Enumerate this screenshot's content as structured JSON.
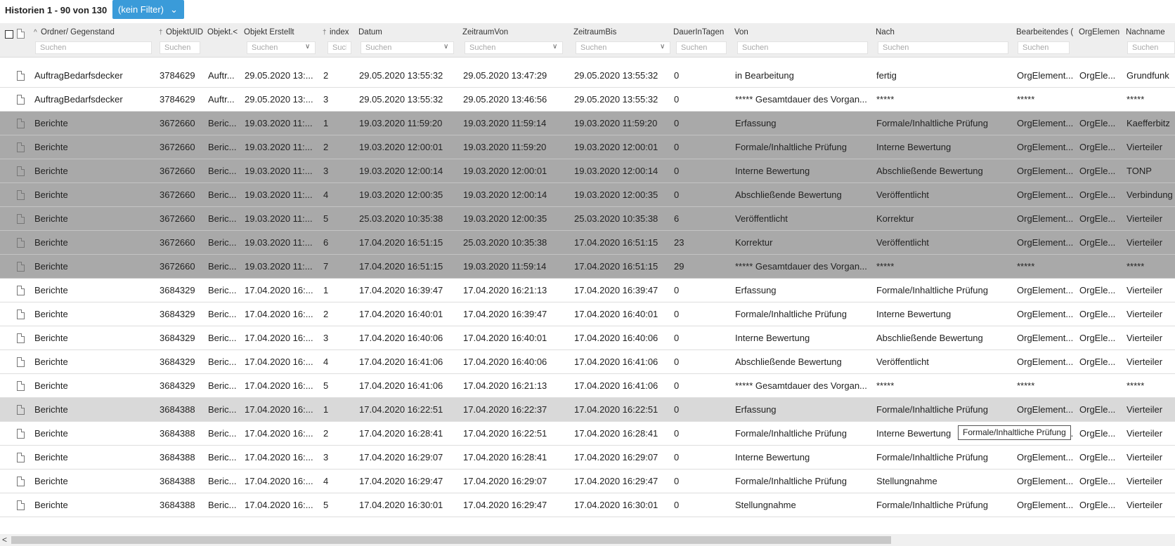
{
  "toolbar": {
    "title": "Historien 1 - 90 von 130",
    "filter_label": "(kein Filter)"
  },
  "columns": [
    {
      "key": "ordner",
      "label": "Ordner/ Gegenstand",
      "placeholder": "Suchen"
    },
    {
      "key": "uid",
      "label": "ObjektUID",
      "placeholder": "Suchen"
    },
    {
      "key": "objekt",
      "label": "Objekt.<",
      "placeholder": ""
    },
    {
      "key": "erstellt",
      "label": "Objekt Erstellt",
      "placeholder": "Suchen"
    },
    {
      "key": "index",
      "label": "index",
      "placeholder": "Suche"
    },
    {
      "key": "datum",
      "label": "Datum",
      "placeholder": "Suchen"
    },
    {
      "key": "von_zeit",
      "label": "ZeitraumVon",
      "placeholder": "Suchen"
    },
    {
      "key": "bis_zeit",
      "label": "ZeitraumBis",
      "placeholder": "Suchen"
    },
    {
      "key": "dauer",
      "label": "DauerInTagen",
      "placeholder": "Suchen"
    },
    {
      "key": "von",
      "label": "Von",
      "placeholder": "Suchen"
    },
    {
      "key": "nach",
      "label": "Nach",
      "placeholder": "Suchen"
    },
    {
      "key": "bearb",
      "label": "Bearbeitendes (",
      "placeholder": "Suchen"
    },
    {
      "key": "org",
      "label": "OrgElemen",
      "placeholder": ""
    },
    {
      "key": "nachname",
      "label": "Nachname",
      "placeholder": "Suchen"
    }
  ],
  "rows": [
    {
      "state": "normal",
      "cells": [
        "AuftragBedarfsdecker",
        "3784629",
        "Auftr...",
        "29.05.2020 13:...",
        "2",
        "29.05.2020 13:55:32",
        "29.05.2020 13:47:29",
        "29.05.2020 13:55:32",
        "0",
        "in Bearbeitung",
        "fertig",
        "OrgElement...",
        "OrgEle...",
        "Grundfunk"
      ]
    },
    {
      "state": "normal",
      "cells": [
        "AuftragBedarfsdecker",
        "3784629",
        "Auftr...",
        "29.05.2020 13:...",
        "3",
        "29.05.2020 13:55:32",
        "29.05.2020 13:46:56",
        "29.05.2020 13:55:32",
        "0",
        "***** Gesamtdauer des Vorgan...",
        "*****",
        "*****",
        "",
        "*****"
      ]
    },
    {
      "state": "sel",
      "cells": [
        "Berichte",
        "3672660",
        "Beric...",
        "19.03.2020 11:...",
        "1",
        "19.03.2020 11:59:20",
        "19.03.2020 11:59:14",
        "19.03.2020 11:59:20",
        "0",
        "Erfassung",
        "Formale/Inhaltliche Prüfung",
        "OrgElement...",
        "OrgEle...",
        "Kaefferbitz"
      ]
    },
    {
      "state": "sel",
      "cells": [
        "Berichte",
        "3672660",
        "Beric...",
        "19.03.2020 11:...",
        "2",
        "19.03.2020 12:00:01",
        "19.03.2020 11:59:20",
        "19.03.2020 12:00:01",
        "0",
        "Formale/Inhaltliche Prüfung",
        "Interne Bewertung",
        "OrgElement...",
        "OrgEle...",
        "Vierteiler"
      ]
    },
    {
      "state": "sel",
      "cells": [
        "Berichte",
        "3672660",
        "Beric...",
        "19.03.2020 11:...",
        "3",
        "19.03.2020 12:00:14",
        "19.03.2020 12:00:01",
        "19.03.2020 12:00:14",
        "0",
        "Interne Bewertung",
        "Abschließende Bewertung",
        "OrgElement...",
        "OrgEle...",
        "TONP"
      ]
    },
    {
      "state": "sel",
      "cells": [
        "Berichte",
        "3672660",
        "Beric...",
        "19.03.2020 11:...",
        "4",
        "19.03.2020 12:00:35",
        "19.03.2020 12:00:14",
        "19.03.2020 12:00:35",
        "0",
        "Abschließende Bewertung",
        "Veröffentlicht",
        "OrgElement...",
        "OrgEle...",
        "Verbindung"
      ]
    },
    {
      "state": "sel",
      "cells": [
        "Berichte",
        "3672660",
        "Beric...",
        "19.03.2020 11:...",
        "5",
        "25.03.2020 10:35:38",
        "19.03.2020 12:00:35",
        "25.03.2020 10:35:38",
        "6",
        "Veröffentlicht",
        "Korrektur",
        "OrgElement...",
        "OrgEle...",
        "Vierteiler"
      ]
    },
    {
      "state": "sel",
      "cells": [
        "Berichte",
        "3672660",
        "Beric...",
        "19.03.2020 11:...",
        "6",
        "17.04.2020 16:51:15",
        "25.03.2020 10:35:38",
        "17.04.2020 16:51:15",
        "23",
        "Korrektur",
        "Veröffentlicht",
        "OrgElement...",
        "OrgEle...",
        "Vierteiler"
      ]
    },
    {
      "state": "sel",
      "cells": [
        "Berichte",
        "3672660",
        "Beric...",
        "19.03.2020 11:...",
        "7",
        "17.04.2020 16:51:15",
        "19.03.2020 11:59:14",
        "17.04.2020 16:51:15",
        "29",
        "***** Gesamtdauer des Vorgan...",
        "*****",
        "*****",
        "",
        "*****"
      ]
    },
    {
      "state": "normal",
      "cells": [
        "Berichte",
        "3684329",
        "Beric...",
        "17.04.2020 16:...",
        "1",
        "17.04.2020 16:39:47",
        "17.04.2020 16:21:13",
        "17.04.2020 16:39:47",
        "0",
        "Erfassung",
        "Formale/Inhaltliche Prüfung",
        "OrgElement...",
        "OrgEle...",
        "Vierteiler"
      ]
    },
    {
      "state": "normal",
      "cells": [
        "Berichte",
        "3684329",
        "Beric...",
        "17.04.2020 16:...",
        "2",
        "17.04.2020 16:40:01",
        "17.04.2020 16:39:47",
        "17.04.2020 16:40:01",
        "0",
        "Formale/Inhaltliche Prüfung",
        "Interne Bewertung",
        "OrgElement...",
        "OrgEle...",
        "Vierteiler"
      ]
    },
    {
      "state": "normal",
      "cells": [
        "Berichte",
        "3684329",
        "Beric...",
        "17.04.2020 16:...",
        "3",
        "17.04.2020 16:40:06",
        "17.04.2020 16:40:01",
        "17.04.2020 16:40:06",
        "0",
        "Interne Bewertung",
        "Abschließende Bewertung",
        "OrgElement...",
        "OrgEle...",
        "Vierteiler"
      ]
    },
    {
      "state": "normal",
      "cells": [
        "Berichte",
        "3684329",
        "Beric...",
        "17.04.2020 16:...",
        "4",
        "17.04.2020 16:41:06",
        "17.04.2020 16:40:06",
        "17.04.2020 16:41:06",
        "0",
        "Abschließende Bewertung",
        "Veröffentlicht",
        "OrgElement...",
        "OrgEle...",
        "Vierteiler"
      ]
    },
    {
      "state": "normal",
      "cells": [
        "Berichte",
        "3684329",
        "Beric...",
        "17.04.2020 16:...",
        "5",
        "17.04.2020 16:41:06",
        "17.04.2020 16:21:13",
        "17.04.2020 16:41:06",
        "0",
        "***** Gesamtdauer des Vorgan...",
        "*****",
        "*****",
        "",
        "*****"
      ]
    },
    {
      "state": "hover",
      "cells": [
        "Berichte",
        "3684388",
        "Beric...",
        "17.04.2020 16:...",
        "1",
        "17.04.2020 16:22:51",
        "17.04.2020 16:22:37",
        "17.04.2020 16:22:51",
        "0",
        "Erfassung",
        "Formale/Inhaltliche Prüfung",
        "OrgElement...",
        "OrgEle...",
        "Vierteiler"
      ]
    },
    {
      "state": "normal",
      "cells": [
        "Berichte",
        "3684388",
        "Beric...",
        "17.04.2020 16:...",
        "2",
        "17.04.2020 16:28:41",
        "17.04.2020 16:22:51",
        "17.04.2020 16:28:41",
        "0",
        "Formale/Inhaltliche Prüfung",
        "Interne Bewertung",
        "OrgElement...",
        "OrgEle...",
        "Vierteiler"
      ]
    },
    {
      "state": "normal",
      "cells": [
        "Berichte",
        "3684388",
        "Beric...",
        "17.04.2020 16:...",
        "3",
        "17.04.2020 16:29:07",
        "17.04.2020 16:28:41",
        "17.04.2020 16:29:07",
        "0",
        "Interne Bewertung",
        "Formale/Inhaltliche Prüfung",
        "OrgElement...",
        "OrgEle...",
        "Vierteiler"
      ]
    },
    {
      "state": "normal",
      "cells": [
        "Berichte",
        "3684388",
        "Beric...",
        "17.04.2020 16:...",
        "4",
        "17.04.2020 16:29:47",
        "17.04.2020 16:29:07",
        "17.04.2020 16:29:47",
        "0",
        "Formale/Inhaltliche Prüfung",
        "Stellungnahme",
        "OrgElement...",
        "OrgEle...",
        "Vierteiler"
      ]
    },
    {
      "state": "normal",
      "cells": [
        "Berichte",
        "3684388",
        "Beric...",
        "17.04.2020 16:...",
        "5",
        "17.04.2020 16:30:01",
        "17.04.2020 16:29:47",
        "17.04.2020 16:30:01",
        "0",
        "Stellungnahme",
        "Formale/Inhaltliche Prüfung",
        "OrgElement...",
        "OrgEle...",
        "Vierteiler"
      ]
    }
  ],
  "tooltip": {
    "text": "Formale/Inhaltliche Prüfung"
  },
  "icons": {
    "sort": "sort-ascending-icon",
    "person": "person-icon",
    "document": "document-icon",
    "dropdown": "chevron-down-icon"
  },
  "colors": {
    "accent": "#3a9bd9",
    "header_bg": "#eeeeee",
    "selected_row": "#a9a9a9",
    "hover_row": "#d9d9d9"
  }
}
